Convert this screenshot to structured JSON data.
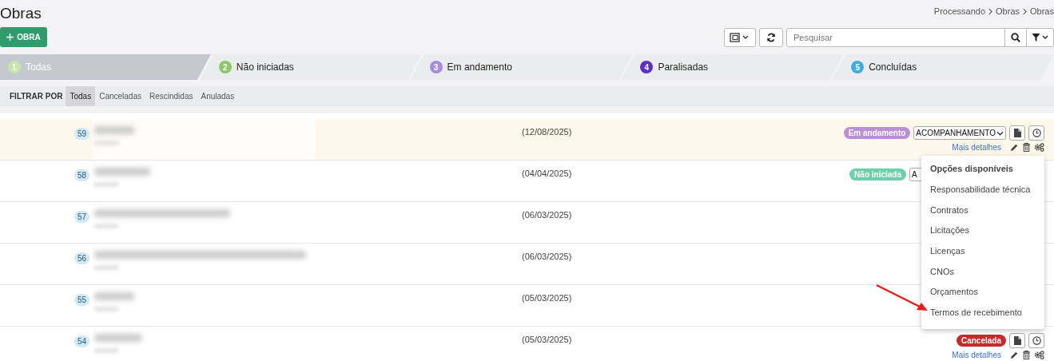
{
  "header": {
    "title": "Obras",
    "breadcrumb": [
      "Processando",
      "Obras",
      "Obras"
    ]
  },
  "toolbar": {
    "new_button": "OBRA",
    "search": {
      "placeholder": "Pesquisar"
    }
  },
  "tabs": [
    {
      "number": "1",
      "label": "Todas",
      "color": "#c8e6a8",
      "selected": true
    },
    {
      "number": "2",
      "label": "Não iniciadas",
      "color": "#8cc76a",
      "selected": false
    },
    {
      "number": "3",
      "label": "Em andamento",
      "color": "#a98be0",
      "selected": false
    },
    {
      "number": "4",
      "label": "Paralisadas",
      "color": "#5a2fc2",
      "selected": false
    },
    {
      "number": "5",
      "label": "Concluídas",
      "color": "#3daee3",
      "selected": false
    }
  ],
  "filter": {
    "label": "FILTRAR POR",
    "options": [
      {
        "label": "Todas",
        "selected": true
      },
      {
        "label": "Canceladas",
        "selected": false
      },
      {
        "label": "Rescindidas",
        "selected": false
      },
      {
        "label": "Anuladas",
        "selected": false
      }
    ]
  },
  "rows": [
    {
      "number": "59",
      "date": "(12/08/2025)",
      "highlighted": true,
      "status": {
        "label": "Em andamento",
        "color": "#bb8fd3"
      },
      "stage": "ACOMPANHAMENTO",
      "details_link": "Mais detalhes"
    },
    {
      "number": "58",
      "date": "(04/04/2025)",
      "highlighted": false,
      "status": {
        "label": "Não iniciada",
        "color": "#6fcfa9"
      },
      "stage": "A"
    },
    {
      "number": "57",
      "date": "(06/03/2025)",
      "highlighted": false
    },
    {
      "number": "56",
      "date": "(06/03/2025)",
      "highlighted": false
    },
    {
      "number": "55",
      "date": "(05/03/2025)",
      "highlighted": false
    },
    {
      "number": "54",
      "date": "(05/03/2025)",
      "highlighted": false,
      "status": {
        "label": "Cancelada",
        "color": "#c62a2a"
      },
      "details_link": "Mais detalhes"
    }
  ],
  "menu": {
    "title": "Opções disponíveis",
    "items": [
      "Responsabilidade técnica",
      "Contratos",
      "Licitações",
      "Licenças",
      "CNOs",
      "Orçamentos",
      "Termos de recebimento"
    ]
  }
}
